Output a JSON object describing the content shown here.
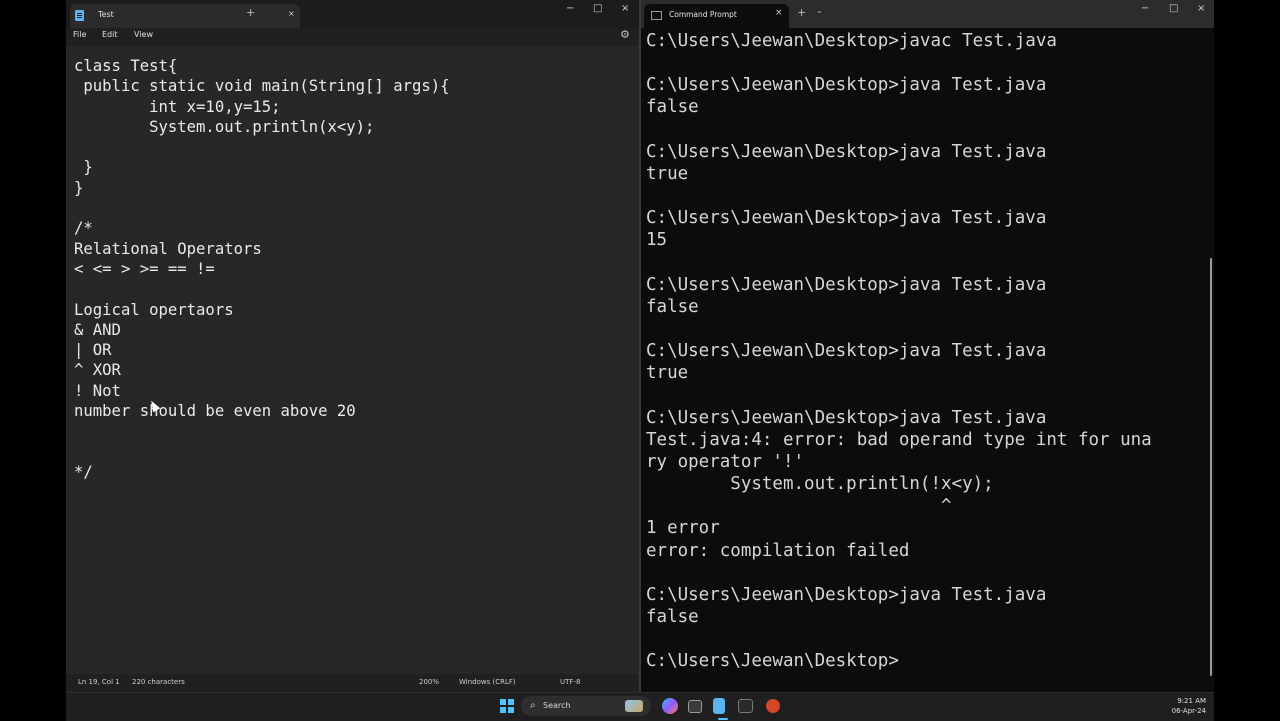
{
  "notepad": {
    "tab_title": "Test",
    "tab_close": "×",
    "new_tab": "+",
    "window_controls": {
      "minimize": "−",
      "maximize": "□",
      "close": "×"
    },
    "menu": [
      "File",
      "Edit",
      "View"
    ],
    "settings_icon": "gear-icon",
    "content": "class Test{\n public static void main(String[] args){\n        int x=10,y=15;\n        System.out.println(x<y);\n\n }\n}\n\n/*\nRelational Operators\n< <= > >= == !=\n\nLogical opertaors\n& AND\n| OR\n^ XOR\n! Not\nnumber should be even above 20\n\n\n*/",
    "status": {
      "position": "Ln 19, Col 1",
      "characters": "220 characters",
      "zoom": "200%",
      "line_ending": "Windows (CRLF)",
      "encoding": "UTF-8"
    }
  },
  "terminal": {
    "tab_title": "Command Prompt",
    "tab_close": "×",
    "new_tab": "+",
    "dropdown": "⌄",
    "window_controls": {
      "minimize": "−",
      "maximize": "□",
      "close": "×"
    },
    "output": "C:\\Users\\Jeewan\\Desktop>javac Test.java\n\nC:\\Users\\Jeewan\\Desktop>java Test.java\nfalse\n\nC:\\Users\\Jeewan\\Desktop>java Test.java\ntrue\n\nC:\\Users\\Jeewan\\Desktop>java Test.java\n15\n\nC:\\Users\\Jeewan\\Desktop>java Test.java\nfalse\n\nC:\\Users\\Jeewan\\Desktop>java Test.java\ntrue\n\nC:\\Users\\Jeewan\\Desktop>java Test.java\nTest.java:4: error: bad operand type int for una\nry operator '!'\n        System.out.println(!x<y);\n                            ^\n1 error\nerror: compilation failed\n\nC:\\Users\\Jeewan\\Desktop>java Test.java\nfalse\n\nC:\\Users\\Jeewan\\Desktop>"
  },
  "taskbar": {
    "search_placeholder": "Search",
    "time": "9:21 AM",
    "date": "06-Apr-24"
  },
  "colors": {
    "accent": "#4cc2ff",
    "notepad_bg": "#272727",
    "terminal_bg": "#0c0c0c"
  }
}
